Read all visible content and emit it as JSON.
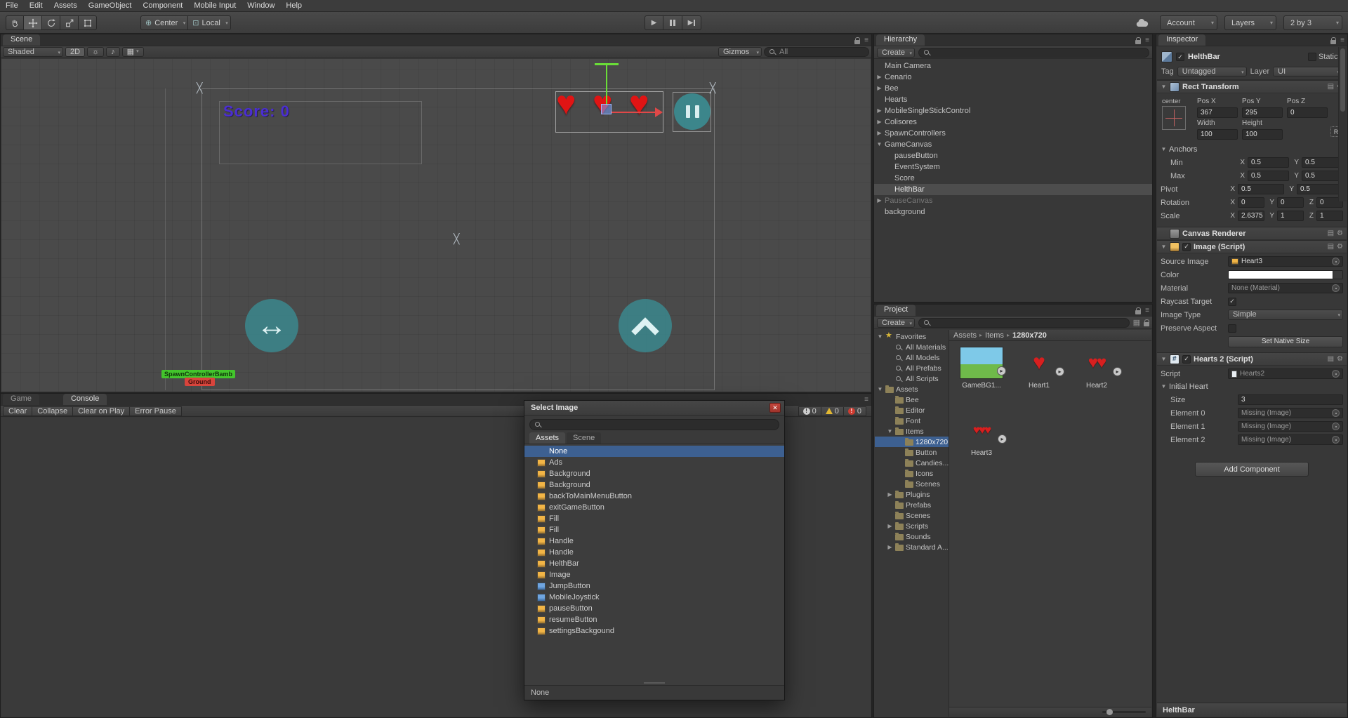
{
  "menubar": {
    "items": [
      {
        "label": "File"
      },
      {
        "label": "Edit"
      },
      {
        "label": "Assets"
      },
      {
        "label": "GameObject"
      },
      {
        "label": "Component"
      },
      {
        "label": "Mobile Input"
      },
      {
        "label": "Window"
      },
      {
        "label": "Help"
      }
    ]
  },
  "toolbar": {
    "pivot_label": "Center",
    "space_label": "Local",
    "account_label": "Account",
    "layers_label": "Layers",
    "layout_label": "2 by 3"
  },
  "scene": {
    "tab": "Scene",
    "shading": "Shaded",
    "mode_2d": "2D",
    "gizmos_label": "Gizmos",
    "search_text": "All",
    "score_text": "Score: 0",
    "spawn_label": "SpawnControllerBamb",
    "ground_label": "Ground"
  },
  "game_tab": "Game",
  "console": {
    "tab": "Console",
    "buttons": [
      {
        "label": "Clear"
      },
      {
        "label": "Collapse"
      },
      {
        "label": "Clear on Play"
      },
      {
        "label": "Error Pause"
      }
    ],
    "info_count": "0",
    "warn_count": "0",
    "error_count": "0"
  },
  "hierarchy": {
    "tab": "Hierarchy",
    "create_label": "Create",
    "items": [
      {
        "label": "Main Camera",
        "level": "lvl0",
        "expand": "none",
        "state": ""
      },
      {
        "label": "Cenario",
        "level": "lvl0",
        "expand": "collapsed",
        "state": ""
      },
      {
        "label": "Bee",
        "level": "lvl0",
        "expand": "collapsed",
        "state": ""
      },
      {
        "label": "Hearts",
        "level": "lvl0",
        "expand": "none",
        "state": ""
      },
      {
        "label": "MobileSingleStickControl",
        "level": "lvl0",
        "expand": "collapsed",
        "state": ""
      },
      {
        "label": "Colisores",
        "level": "lvl0",
        "expand": "collapsed",
        "state": ""
      },
      {
        "label": "SpawnControllers",
        "level": "lvl0",
        "expand": "collapsed",
        "state": ""
      },
      {
        "label": "GameCanvas",
        "level": "lvl0",
        "expand": "expanded",
        "state": ""
      },
      {
        "label": "pauseButton",
        "level": "lvl1",
        "expand": "none",
        "state": ""
      },
      {
        "label": "EventSystem",
        "level": "lvl1",
        "expand": "none",
        "state": ""
      },
      {
        "label": "Score",
        "level": "lvl1",
        "expand": "none",
        "state": ""
      },
      {
        "label": "HelthBar",
        "level": "lvl1",
        "expand": "none",
        "state": "selgray"
      },
      {
        "label": "PauseCanvas",
        "level": "lvl0",
        "expand": "collapsed",
        "state": "disabled"
      },
      {
        "label": "background",
        "level": "lvl0",
        "expand": "none",
        "state": ""
      }
    ]
  },
  "project": {
    "tab": "Project",
    "create_label": "Create",
    "tree": [
      {
        "label": "Favorites",
        "level": "lvl0",
        "expand": "expanded",
        "icon": "star",
        "state": ""
      },
      {
        "label": "All Materials",
        "level": "lvl1",
        "expand": "none",
        "icon": "mag2",
        "state": ""
      },
      {
        "label": "All Models",
        "level": "lvl1",
        "expand": "none",
        "icon": "mag2",
        "state": ""
      },
      {
        "label": "All Prefabs",
        "level": "lvl1",
        "expand": "none",
        "icon": "mag2",
        "state": ""
      },
      {
        "label": "All Scripts",
        "level": "lvl1",
        "expand": "none",
        "icon": "mag2",
        "state": ""
      },
      {
        "label": "Assets",
        "level": "lvl0",
        "expand": "expanded",
        "icon": "fold",
        "state": ""
      },
      {
        "label": "Bee",
        "level": "lvl1",
        "expand": "none",
        "icon": "fold",
        "state": ""
      },
      {
        "label": "Editor",
        "level": "lvl1",
        "expand": "none",
        "icon": "fold",
        "state": ""
      },
      {
        "label": "Font",
        "level": "lvl1",
        "expand": "none",
        "icon": "fold",
        "state": ""
      },
      {
        "label": "Items",
        "level": "lvl1",
        "expand": "expanded",
        "icon": "fold",
        "state": ""
      },
      {
        "label": "1280x720",
        "level": "lvl2",
        "expand": "none",
        "icon": "fold",
        "state": "selected"
      },
      {
        "label": "Button",
        "level": "lvl2",
        "expand": "none",
        "icon": "fold",
        "state": ""
      },
      {
        "label": "Candies...",
        "level": "lvl2",
        "expand": "none",
        "icon": "fold",
        "state": ""
      },
      {
        "label": "Icons",
        "level": "lvl2",
        "expand": "none",
        "icon": "fold",
        "state": ""
      },
      {
        "label": "Scenes",
        "level": "lvl2",
        "expand": "none",
        "icon": "fold",
        "state": ""
      },
      {
        "label": "Plugins",
        "level": "lvl1",
        "expand": "collapsed",
        "icon": "fold",
        "state": ""
      },
      {
        "label": "Prefabs",
        "level": "lvl1",
        "expand": "none",
        "icon": "fold",
        "state": ""
      },
      {
        "label": "Scenes",
        "level": "lvl1",
        "expand": "none",
        "icon": "fold",
        "state": ""
      },
      {
        "label": "Scripts",
        "level": "lvl1",
        "expand": "collapsed",
        "icon": "fold",
        "state": ""
      },
      {
        "label": "Sounds",
        "level": "lvl1",
        "expand": "none",
        "icon": "fold",
        "state": ""
      },
      {
        "label": "Standard A...",
        "level": "lvl1",
        "expand": "collapsed",
        "icon": "fold",
        "state": ""
      }
    ],
    "breadcrumb": {
      "root": "Assets",
      "mid": "Items",
      "leaf": "1280x720"
    },
    "thumbs": [
      {
        "label": "GameBG1...",
        "kind": "bg"
      },
      {
        "label": "Heart1",
        "kind": "h1"
      },
      {
        "label": "Heart2",
        "kind": "h2"
      },
      {
        "label": "Heart3",
        "kind": "h3"
      }
    ]
  },
  "dialog": {
    "title": "Select Image",
    "tab_assets": "Assets",
    "tab_scene": "Scene",
    "items": [
      {
        "label": "None",
        "icon": "noicon",
        "state": "selected"
      },
      {
        "label": "Ads",
        "icon": "sprite",
        "state": ""
      },
      {
        "label": "Background",
        "icon": "sprite",
        "state": ""
      },
      {
        "label": "Background",
        "icon": "sprite",
        "state": ""
      },
      {
        "label": "backToMainMenuButton",
        "icon": "sprite",
        "state": ""
      },
      {
        "label": "exitGameButton",
        "icon": "sprite",
        "state": ""
      },
      {
        "label": "Fill",
        "icon": "sprite",
        "state": ""
      },
      {
        "label": "Fill",
        "icon": "sprite",
        "state": ""
      },
      {
        "label": "Handle",
        "icon": "sprite",
        "state": ""
      },
      {
        "label": "Handle",
        "icon": "sprite",
        "state": ""
      },
      {
        "label": "HelthBar",
        "icon": "sprite",
        "state": ""
      },
      {
        "label": "Image",
        "icon": "sprite",
        "state": ""
      },
      {
        "label": "JumpButton",
        "icon": "sprite-blue",
        "state": ""
      },
      {
        "label": "MobileJoystick",
        "icon": "sprite-blue",
        "state": ""
      },
      {
        "label": "pauseButton",
        "icon": "sprite",
        "state": ""
      },
      {
        "label": "resumeButton",
        "icon": "sprite",
        "state": ""
      },
      {
        "label": "settingsBackgound",
        "icon": "sprite",
        "state": ""
      }
    ],
    "status": "None"
  },
  "inspector": {
    "tab": "Inspector",
    "header": {
      "name": "HelthBar",
      "static_label": "Static",
      "tag_label": "Tag",
      "tag_value": "Untagged",
      "layer_label": "Layer",
      "layer_value": "UI"
    },
    "axis": {
      "x": "X",
      "y": "Y",
      "z": "Z"
    },
    "rect_transform": {
      "title": "Rect Transform",
      "anchor_preset": "center",
      "pos_x_label": "Pos X",
      "pos_x": "367",
      "pos_y_label": "Pos Y",
      "pos_y": "295",
      "pos_z_label": "Pos Z",
      "pos_z": "0",
      "width_label": "Width",
      "width": "100",
      "height_label": "Height",
      "height": "100",
      "r_button": "R",
      "anchors_label": "Anchors",
      "min_label": "Min",
      "min_x": "0.5",
      "min_y": "0.5",
      "max_label": "Max",
      "max_x": "0.5",
      "max_y": "0.5",
      "pivot_label": "Pivot",
      "pivot_x": "0.5",
      "pivot_y": "0.5",
      "rotation_label": "Rotation",
      "rot_x": "0",
      "rot_y": "0",
      "rot_z": "0",
      "scale_label": "Scale",
      "scale_x": "2.6375",
      "scale_y": "1",
      "scale_z": "1"
    },
    "canvas_renderer": {
      "title": "Canvas Renderer"
    },
    "image": {
      "title": "Image (Script)",
      "source_label": "Source Image",
      "source_value": "Heart3",
      "color_label": "Color",
      "material_label": "Material",
      "material_value": "None (Material)",
      "raycast_label": "Raycast Target",
      "type_label": "Image Type",
      "type_value": "Simple",
      "preserve_label": "Preserve Aspect",
      "native_size_button": "Set Native Size"
    },
    "hearts2": {
      "title": "Hearts 2 (Script)",
      "script_label": "Script",
      "script_value": "Hearts2",
      "initial_label": "Initial Heart",
      "size_label": "Size",
      "size_value": "3",
      "elements": [
        {
          "label": "Element 0",
          "value": "Missing (Image)"
        },
        {
          "label": "Element 1",
          "value": "Missing (Image)"
        },
        {
          "label": "Element 2",
          "value": "Missing (Image)"
        }
      ]
    },
    "add_component": "Add Component",
    "preview_title": "HelthBar"
  },
  "colors": {
    "selection_blue": "#3d6091",
    "heart_red": "#e01414",
    "control_teal": "#3a8a90",
    "score_purple": "#4b2ed2",
    "gizmo_green": "#6ade38",
    "gizmo_red": "#e04848"
  }
}
